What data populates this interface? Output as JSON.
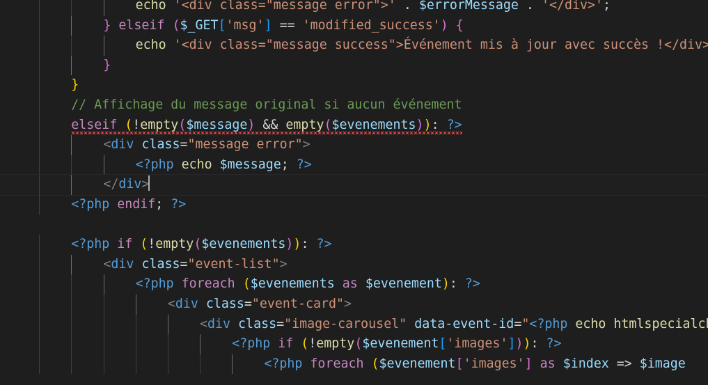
{
  "editor": {
    "theme_colors": {
      "background": "#1e1e1e",
      "default": "#d4d4d4",
      "keyword": "#c586c0",
      "string": "#ce9178",
      "variable": "#9cdcfe",
      "comment": "#6a9955",
      "tag": "#569cd6",
      "php_tag": "#569cd6",
      "punctuation": "#808080",
      "bracket_gold": "#ffd700",
      "bracket_purple": "#da70d6",
      "bracket_blue": "#179fff",
      "function": "#dcdcaa",
      "error": "#f14c4c"
    },
    "lines": [
      {
        "indent": 4,
        "tokens": [
          {
            "t": "echo ",
            "c": "func"
          },
          {
            "t": "'<div class=\"message error\">'",
            "c": "str"
          },
          {
            "t": " . ",
            "c": "def"
          },
          {
            "t": "$errorMessage",
            "c": "var"
          },
          {
            "t": " . ",
            "c": "def"
          },
          {
            "t": "'</div>'",
            "c": "str"
          },
          {
            "t": ";",
            "c": "def"
          }
        ]
      },
      {
        "indent": 3,
        "tokens": [
          {
            "t": "}",
            "c": "br2"
          },
          {
            "t": " elseif ",
            "c": "kw"
          },
          {
            "t": "(",
            "c": "br2"
          },
          {
            "t": "$_GET",
            "c": "var"
          },
          {
            "t": "[",
            "c": "br3"
          },
          {
            "t": "'msg'",
            "c": "str"
          },
          {
            "t": "]",
            "c": "br3"
          },
          {
            "t": " == ",
            "c": "def"
          },
          {
            "t": "'modified_success'",
            "c": "str"
          },
          {
            "t": ")",
            "c": "br2"
          },
          {
            "t": " {",
            "c": "br2"
          }
        ]
      },
      {
        "indent": 4,
        "tokens": [
          {
            "t": "echo ",
            "c": "func"
          },
          {
            "t": "'<div class=\"message success\">Événement mis à jour avec succès !</div>';",
            "c": "str"
          }
        ]
      },
      {
        "indent": 3,
        "tokens": [
          {
            "t": "}",
            "c": "br2"
          }
        ]
      },
      {
        "indent": 2,
        "tokens": [
          {
            "t": "}",
            "c": "br1"
          }
        ]
      },
      {
        "indent": 2,
        "tokens": [
          {
            "t": "// Affichage du message original si aucun événement",
            "c": "cmt"
          }
        ]
      },
      {
        "indent": 2,
        "squiggle": true,
        "tokens": [
          {
            "t": "elseif ",
            "c": "kw"
          },
          {
            "t": "(",
            "c": "br1"
          },
          {
            "t": "!",
            "c": "def"
          },
          {
            "t": "empty",
            "c": "func"
          },
          {
            "t": "(",
            "c": "br2"
          },
          {
            "t": "$message",
            "c": "var"
          },
          {
            "t": ")",
            "c": "br2"
          },
          {
            "t": " && ",
            "c": "def"
          },
          {
            "t": "empty",
            "c": "func"
          },
          {
            "t": "(",
            "c": "br2"
          },
          {
            "t": "$evenements",
            "c": "var"
          },
          {
            "t": ")",
            "c": "br2"
          },
          {
            "t": ")",
            "c": "br1"
          },
          {
            "t": ": ",
            "c": "def"
          },
          {
            "t": "?>",
            "c": "php"
          }
        ]
      },
      {
        "indent": 3,
        "tokens": [
          {
            "t": "<",
            "c": "punc"
          },
          {
            "t": "div",
            "c": "tag"
          },
          {
            "t": " class",
            "c": "var"
          },
          {
            "t": "=",
            "c": "def"
          },
          {
            "t": "\"message error\"",
            "c": "str"
          },
          {
            "t": ">",
            "c": "punc"
          }
        ]
      },
      {
        "indent": 4,
        "tokens": [
          {
            "t": "<?php",
            "c": "php"
          },
          {
            "t": " echo ",
            "c": "func"
          },
          {
            "t": "$message",
            "c": "var"
          },
          {
            "t": "; ",
            "c": "def"
          },
          {
            "t": "?>",
            "c": "php"
          }
        ]
      },
      {
        "indent": 3,
        "current": true,
        "cursor": true,
        "tokens": [
          {
            "t": "</",
            "c": "punc"
          },
          {
            "t": "div",
            "c": "tag"
          },
          {
            "t": ">",
            "c": "punc"
          }
        ]
      },
      {
        "indent": 2,
        "tokens": [
          {
            "t": "<?php",
            "c": "php"
          },
          {
            "t": " endif",
            "c": "kw"
          },
          {
            "t": "; ",
            "c": "def"
          },
          {
            "t": "?>",
            "c": "php"
          }
        ]
      },
      {
        "indent": 0,
        "tokens": []
      },
      {
        "indent": 2,
        "tokens": [
          {
            "t": "<?php",
            "c": "php"
          },
          {
            "t": " if ",
            "c": "kw"
          },
          {
            "t": "(",
            "c": "br1"
          },
          {
            "t": "!",
            "c": "def"
          },
          {
            "t": "empty",
            "c": "func"
          },
          {
            "t": "(",
            "c": "br2"
          },
          {
            "t": "$evenements",
            "c": "var"
          },
          {
            "t": ")",
            "c": "br2"
          },
          {
            "t": ")",
            "c": "br1"
          },
          {
            "t": ": ",
            "c": "def"
          },
          {
            "t": "?>",
            "c": "php"
          }
        ]
      },
      {
        "indent": 3,
        "tokens": [
          {
            "t": "<",
            "c": "punc"
          },
          {
            "t": "div",
            "c": "tag"
          },
          {
            "t": " class",
            "c": "var"
          },
          {
            "t": "=",
            "c": "def"
          },
          {
            "t": "\"event-list\"",
            "c": "str"
          },
          {
            "t": ">",
            "c": "punc"
          }
        ]
      },
      {
        "indent": 4,
        "tokens": [
          {
            "t": "<?php",
            "c": "php"
          },
          {
            "t": " foreach ",
            "c": "kw"
          },
          {
            "t": "(",
            "c": "br1"
          },
          {
            "t": "$evenements",
            "c": "var"
          },
          {
            "t": " as ",
            "c": "kw"
          },
          {
            "t": "$evenement",
            "c": "var"
          },
          {
            "t": ")",
            "c": "br1"
          },
          {
            "t": ": ",
            "c": "def"
          },
          {
            "t": "?>",
            "c": "php"
          }
        ]
      },
      {
        "indent": 5,
        "tokens": [
          {
            "t": "<",
            "c": "punc"
          },
          {
            "t": "div",
            "c": "tag"
          },
          {
            "t": " class",
            "c": "var"
          },
          {
            "t": "=",
            "c": "def"
          },
          {
            "t": "\"event-card\"",
            "c": "str"
          },
          {
            "t": ">",
            "c": "punc"
          }
        ]
      },
      {
        "indent": 6,
        "tokens": [
          {
            "t": "<",
            "c": "punc"
          },
          {
            "t": "div",
            "c": "tag"
          },
          {
            "t": " class",
            "c": "var"
          },
          {
            "t": "=",
            "c": "def"
          },
          {
            "t": "\"image-carousel\"",
            "c": "str"
          },
          {
            "t": " data-event-id",
            "c": "var"
          },
          {
            "t": "=",
            "c": "def"
          },
          {
            "t": "\"",
            "c": "str"
          },
          {
            "t": "<?php",
            "c": "php"
          },
          {
            "t": " echo htmlspecialchars",
            "c": "func"
          }
        ]
      },
      {
        "indent": 7,
        "tokens": [
          {
            "t": "<?php",
            "c": "php"
          },
          {
            "t": " if ",
            "c": "kw"
          },
          {
            "t": "(",
            "c": "br1"
          },
          {
            "t": "!",
            "c": "def"
          },
          {
            "t": "empty",
            "c": "func"
          },
          {
            "t": "(",
            "c": "br2"
          },
          {
            "t": "$evenement",
            "c": "var"
          },
          {
            "t": "[",
            "c": "br3"
          },
          {
            "t": "'images'",
            "c": "str"
          },
          {
            "t": "]",
            "c": "br3"
          },
          {
            "t": ")",
            "c": "br2"
          },
          {
            "t": ")",
            "c": "br1"
          },
          {
            "t": ": ",
            "c": "def"
          },
          {
            "t": "?>",
            "c": "php"
          }
        ]
      },
      {
        "indent": 8,
        "tokens": [
          {
            "t": "<?php",
            "c": "php"
          },
          {
            "t": " foreach ",
            "c": "kw"
          },
          {
            "t": "(",
            "c": "br1"
          },
          {
            "t": "$evenement",
            "c": "var"
          },
          {
            "t": "[",
            "c": "br2"
          },
          {
            "t": "'images'",
            "c": "str"
          },
          {
            "t": "]",
            "c": "br2"
          },
          {
            "t": " as ",
            "c": "kw"
          },
          {
            "t": "$index",
            "c": "var"
          },
          {
            "t": " => ",
            "c": "def"
          },
          {
            "t": "$image",
            "c": "var"
          }
        ]
      }
    ]
  }
}
